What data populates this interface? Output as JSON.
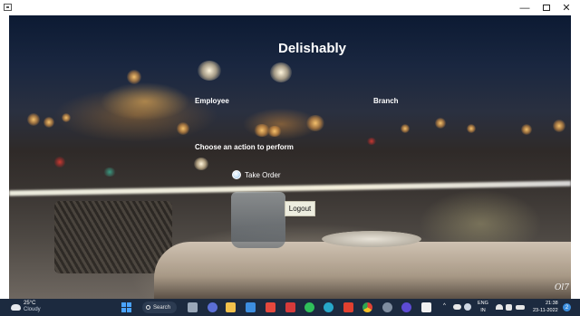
{
  "window": {
    "minimize_glyph": "—",
    "close_glyph": "✕"
  },
  "app": {
    "title": "Delishably",
    "employee_label": "Employee",
    "branch_label": "Branch",
    "prompt": "Choose an action to perform",
    "take_order_label": "Take Order",
    "logout_label": "Logout",
    "watermark": "Ol7"
  },
  "taskbar": {
    "weather_temp": "25°C",
    "weather_condition": "Cloudy",
    "search_label": "Search",
    "tray_chevron": "^",
    "language_top": "ENG",
    "language_bottom": "IN",
    "time": "21:38",
    "date": "23-11-2022",
    "notification_count": "2",
    "icons": [
      "file-explorer-icon",
      "camera-icon",
      "folder-icon",
      "store-icon",
      "office-icon",
      "photos-icon",
      "whatsapp-icon",
      "edge-icon",
      "media-icon",
      "chrome-icon",
      "settings-icon",
      "app-icon",
      "java-icon"
    ],
    "accent": "#4aa3ff"
  }
}
